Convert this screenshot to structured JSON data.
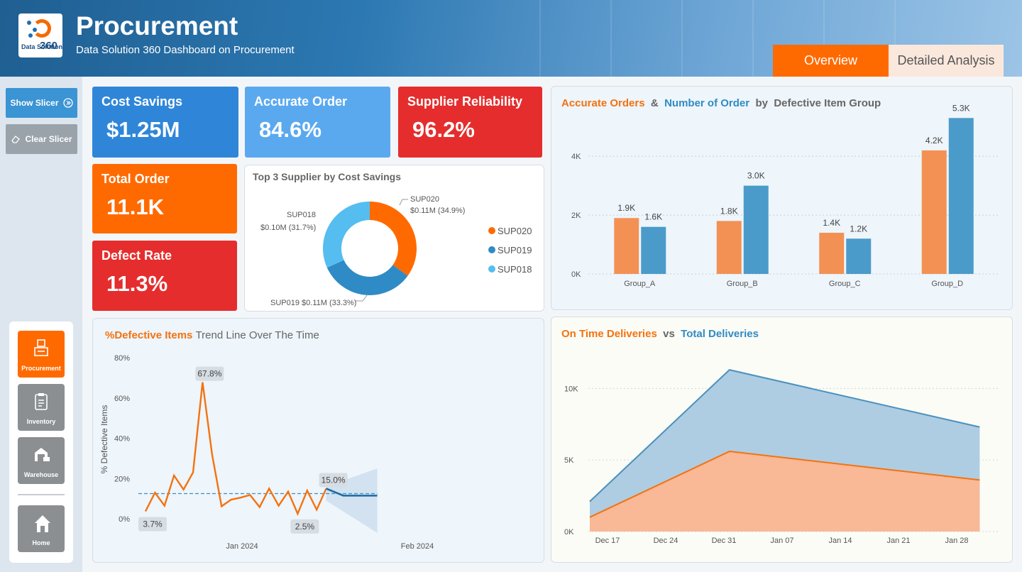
{
  "header": {
    "title": "Procurement",
    "subtitle": "Data Solution 360 Dashboard on Procurement",
    "logo_text": "Data Solution",
    "logo_num": "360",
    "tabs": [
      {
        "label": "Overview",
        "active": true
      },
      {
        "label": "Detailed Analysis",
        "active": false
      }
    ]
  },
  "sidebar": {
    "show_slicer": "Show Slicer",
    "clear_slicer": "Clear Slicer",
    "nav": [
      {
        "label": "Procurement",
        "icon": "procurement-icon",
        "active": true
      },
      {
        "label": "Inventory",
        "icon": "clipboard-icon",
        "active": false
      },
      {
        "label": "Warehouse",
        "icon": "warehouse-icon",
        "active": false
      },
      {
        "label": "Home",
        "icon": "home-icon",
        "active": false
      }
    ]
  },
  "kpis": {
    "cost_savings": {
      "label": "Cost Savings",
      "value": "$1.25M"
    },
    "accurate_order": {
      "label": "Accurate Order",
      "value": "84.6%"
    },
    "supplier_reliability": {
      "label": "Supplier Reliability",
      "value": "96.2%"
    },
    "total_order": {
      "label": "Total Order",
      "value": "11.1K"
    },
    "defect_rate": {
      "label": "Defect Rate",
      "value": "11.3%"
    }
  },
  "colors": {
    "orange": "#f4720f",
    "blue": "#2f8bc5",
    "red": "#e52d2d",
    "bar_orange": "#f39155",
    "bar_blue": "#4a9bc9"
  },
  "chart_data": [
    {
      "type": "pie",
      "title": "Top 3 Supplier by Cost Savings",
      "categories": [
        "SUP020",
        "SUP019",
        "SUP018"
      ],
      "values": [
        0.11,
        0.11,
        0.1
      ],
      "percentages": [
        34.9,
        33.3,
        31.7
      ],
      "labels": [
        "SUP020\n$0.11M (34.9%)",
        "SUP019 $0.11M (33.3%)",
        "SUP018\n$0.10M (31.7%)"
      ],
      "colors": [
        "#ff6a00",
        "#2f8bc5",
        "#55bdf0"
      ],
      "legend_position": "right"
    },
    {
      "type": "bar",
      "title": [
        "Accurate Orders",
        "&",
        "Number of Order",
        "by",
        "Defective Item",
        "Group"
      ],
      "categories": [
        "Group_A",
        "Group_B",
        "Group_C",
        "Group_D"
      ],
      "series": [
        {
          "name": "Accurate Orders",
          "values": [
            1.9,
            1.8,
            1.4,
            4.2
          ],
          "labels": [
            "1.9K",
            "1.8K",
            "1.4K",
            "4.2K"
          ]
        },
        {
          "name": "Number of Order",
          "values": [
            1.6,
            3.0,
            1.2,
            5.3
          ],
          "labels": [
            "1.6K",
            "3.0K",
            "1.2K",
            "5.3K"
          ]
        }
      ],
      "yticks": [
        "0K",
        "2K",
        "4K"
      ],
      "ylim": [
        0,
        5.5
      ],
      "grid": true
    },
    {
      "type": "line",
      "title": [
        "%Defective Items",
        "Trend Line Over The Time"
      ],
      "ylabel": "% Defective Items",
      "yticks": [
        "0%",
        "20%",
        "40%",
        "60%",
        "80%"
      ],
      "ylim": [
        0,
        80
      ],
      "xticks": [
        "Jan 2024",
        "Feb 2024"
      ],
      "values": [
        3.7,
        13,
        6.5,
        21.5,
        14.5,
        23,
        67.8,
        32,
        6.2,
        9.5,
        10.5,
        11.8,
        5.8,
        15,
        6.5,
        13.5,
        2.5,
        14,
        4.5,
        15.0
      ],
      "forecast": [
        15.0,
        11.5,
        11.5,
        11.5
      ],
      "average": 12.5,
      "annotations": [
        {
          "text": "67.8%",
          "index": 6
        },
        {
          "text": "3.7%",
          "index": 0
        },
        {
          "text": "2.5%",
          "index": 16
        },
        {
          "text": "15.0%",
          "index": 19
        }
      ]
    },
    {
      "type": "area",
      "title": [
        "On Time Deliveries",
        "vs",
        "Total Deliveries"
      ],
      "x": [
        "Dec 17",
        "Dec 24",
        "Dec 31",
        "Jan 07",
        "Jan 14",
        "Jan 21",
        "Jan 28"
      ],
      "series": [
        {
          "name": "On Time Deliveries",
          "points": [
            [
              0,
              1.0
            ],
            [
              2.4,
              5.6
            ],
            [
              6.7,
              3.6
            ]
          ]
        },
        {
          "name": "Total Deliveries",
          "points": [
            [
              0,
              2.1
            ],
            [
              2.4,
              11.3
            ],
            [
              6.7,
              7.3
            ]
          ]
        }
      ],
      "yticks": [
        "0K",
        "5K",
        "10K"
      ],
      "ylim": [
        0,
        12
      ],
      "grid": true
    }
  ]
}
